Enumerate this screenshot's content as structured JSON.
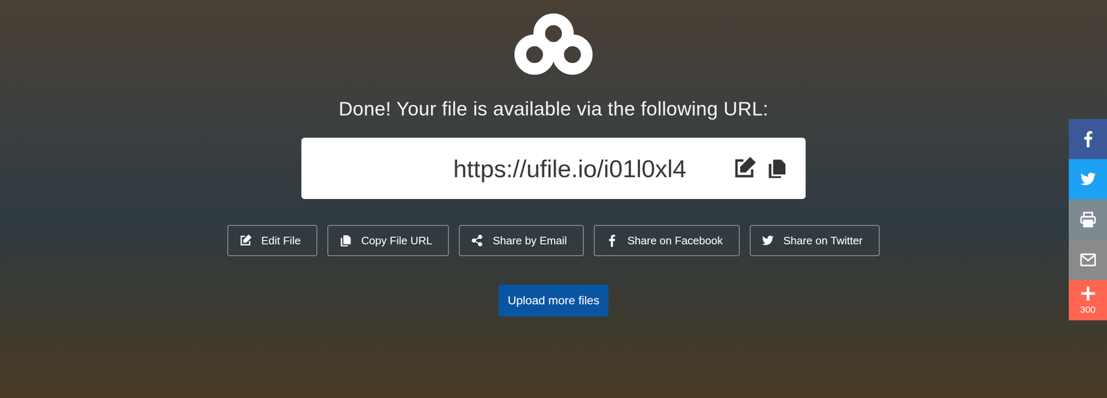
{
  "page": {
    "heading": "Done! Your file is available via the following URL:"
  },
  "url_box": {
    "url": "https://ufile.io/i01l0xl4"
  },
  "actions": [
    {
      "label": "Edit File",
      "kind": "edit"
    },
    {
      "label": "Copy File URL",
      "kind": "copy"
    },
    {
      "label": "Share by Email",
      "kind": "share"
    },
    {
      "label": "Share on Facebook",
      "kind": "facebook"
    },
    {
      "label": "Share on Twitter",
      "kind": "twitter"
    }
  ],
  "upload_button": {
    "label": "Upload more files"
  },
  "share_sidebar": [
    {
      "kind": "facebook",
      "color": "#3b5998"
    },
    {
      "kind": "twitter",
      "color": "#1da1f2"
    },
    {
      "kind": "print",
      "color": "#7d8b90"
    },
    {
      "kind": "email",
      "color": "#8a8a8a"
    },
    {
      "kind": "plus",
      "color": "#ff6550",
      "count": "300"
    }
  ]
}
